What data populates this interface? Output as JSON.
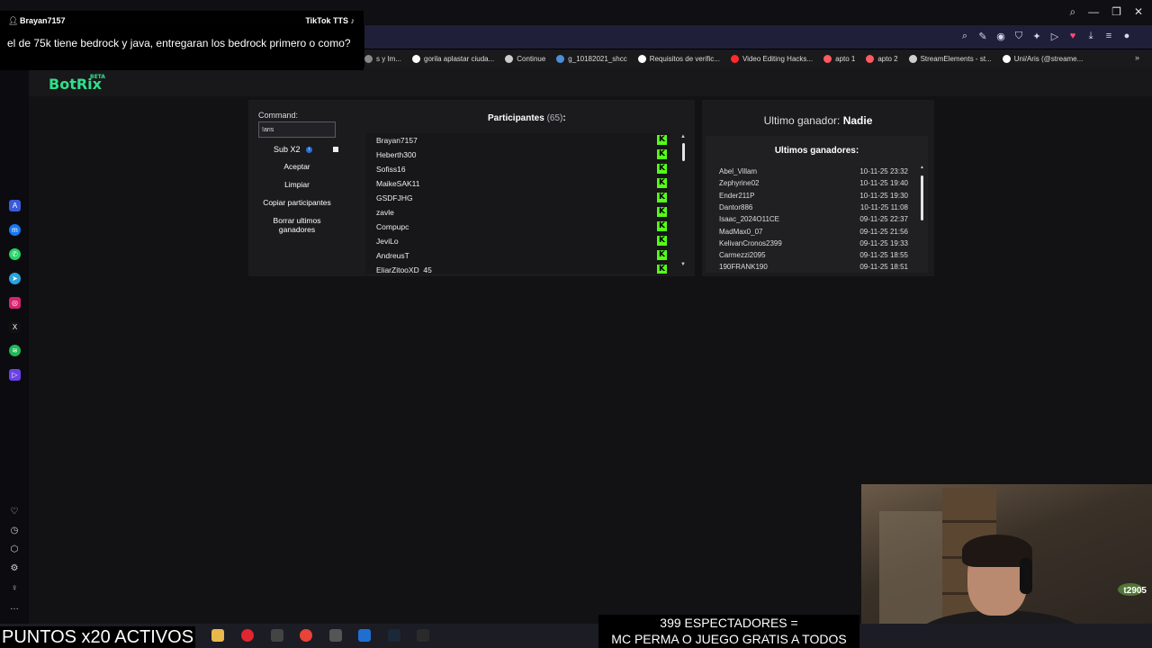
{
  "tts": {
    "username": "Brayan7157",
    "brand": "TikTok TTS",
    "message": "el de 75k tiene bedrock y java, entregaran los bedrock primero o como?"
  },
  "bookmarks": [
    {
      "label": "s y Im...",
      "color": "#888888"
    },
    {
      "label": "gorila aplastar ciuda...",
      "color": "#ffffff"
    },
    {
      "label": "Continue",
      "color": "#cccccc"
    },
    {
      "label": "g_10182021_shcc",
      "color": "#4a8fd8"
    },
    {
      "label": "Requisitos de verific...",
      "color": "#ffffff"
    },
    {
      "label": "Video Editing Hacks...",
      "color": "#ff2a2a"
    },
    {
      "label": "apto 1",
      "color": "#ff5a5f"
    },
    {
      "label": "apto 2",
      "color": "#ff5a5f"
    },
    {
      "label": "StreamElements - st...",
      "color": "#cfcfcf"
    },
    {
      "label": "Uni/Aris (@streame...",
      "color": "#ffffff"
    }
  ],
  "app": {
    "logo": "BotRix",
    "logo_badge": "BETA"
  },
  "controls": {
    "command_label": "Command:",
    "command_value": "!aris",
    "sub_label": "Sub X2",
    "accept": "Aceptar",
    "clear": "Limpiar",
    "copy": "Copiar participantes",
    "delete_winners": "Borrar ultimos ganadores"
  },
  "participants": {
    "title": "Participantes",
    "count": "(65)",
    "colon": ":",
    "names": [
      "Brayan7157",
      "Heberth300",
      "Sofiss16",
      "MaikeSAK11",
      "GSDFJHG",
      "zavle",
      "Compupc",
      "JeviLo",
      "AndreusT",
      "EliarZitooXD_45"
    ],
    "kick_color": "#53fc18"
  },
  "winners": {
    "last_label": "Ultimo ganador:",
    "last_value": "Nadie",
    "title": "Ultimos ganadores:",
    "rows": [
      {
        "name": "Abel_Villam",
        "date": "10-11-25 23:32"
      },
      {
        "name": "Zephyrine02",
        "date": "10-11-25 19:40"
      },
      {
        "name": "Ender211P",
        "date": "10-11-25 19:30"
      },
      {
        "name": "Dantor886",
        "date": "10-11-25 11:08"
      },
      {
        "name": "Isaac_2024O11CE",
        "date": "09-11-25 22:37"
      },
      {
        "name": "MadMax0_07",
        "date": "09-11-25 21:56"
      },
      {
        "name": "KelivanCronos2399",
        "date": "09-11-25 19:33"
      },
      {
        "name": "Carmezzi2095",
        "date": "09-11-25 18:55"
      },
      {
        "name": "190FRANK190",
        "date": "09-11-25 18:51"
      }
    ]
  },
  "overlays": {
    "points": "PUNTOS x20 ACTIVOS",
    "viewers_line1": "399 ESPECTADORES =",
    "viewers_line2": "MC PERMA O JUEGO GRATIS A TODOS",
    "cam_logo": "t2905"
  }
}
